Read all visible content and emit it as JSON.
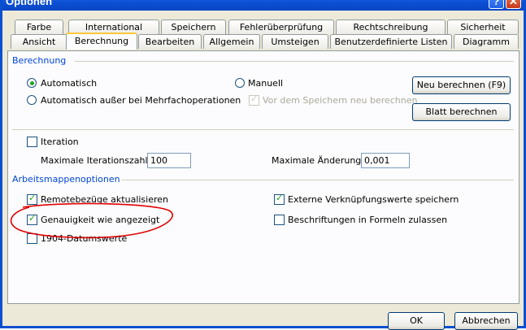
{
  "window": {
    "title": "Optionen",
    "help_label": "?",
    "close_label": "✕"
  },
  "tabs_row1": [
    "Farbe",
    "International",
    "Speichern",
    "Fehlerüberprüfung",
    "Rechtschreibung",
    "Sicherheit"
  ],
  "tabs_row2": [
    "Ansicht",
    "Berechnung",
    "Bearbeiten",
    "Allgemein",
    "Umsteigen",
    "Benutzerdefinierte Listen",
    "Diagramm"
  ],
  "active_tab": "Berechnung",
  "berechnung": {
    "group_label": "Berechnung",
    "radio_auto": "Automatisch",
    "radio_auto_mehrfach": "Automatisch außer bei Mehrfachoperationen",
    "radio_manuell": "Manuell",
    "cb_vor_speichern": "Vor dem Speichern neu berechnen",
    "btn_neu_berechnen": "Neu berechnen (F9)",
    "btn_blatt_berechnen": "Blatt berechnen"
  },
  "iteration": {
    "cb_iteration": "Iteration",
    "max_iter_label": "Maximale Iterationszahl:",
    "max_iter_value": "100",
    "max_change_label": "Maximale Änderung:",
    "max_change_value": "0,001"
  },
  "arbeitsmappe": {
    "group_label": "Arbeitsmappenoptionen",
    "cb_remote": "Remotebezüge aktualisieren",
    "cb_genauigkeit": "Genauigkeit wie angezeigt",
    "cb_1904": "1904-Datumswerte",
    "cb_extern": "Externe Verknüpfungswerte speichern",
    "cb_beschriftungen": "Beschriftungen in Formeln zulassen"
  },
  "footer": {
    "ok_label": "OK",
    "cancel_label": "Abbrechen"
  },
  "colors": {
    "title_bar": "#0a4fd3",
    "group_label": "#0046d5",
    "annotation": "#e00000",
    "check": "#21a121"
  }
}
